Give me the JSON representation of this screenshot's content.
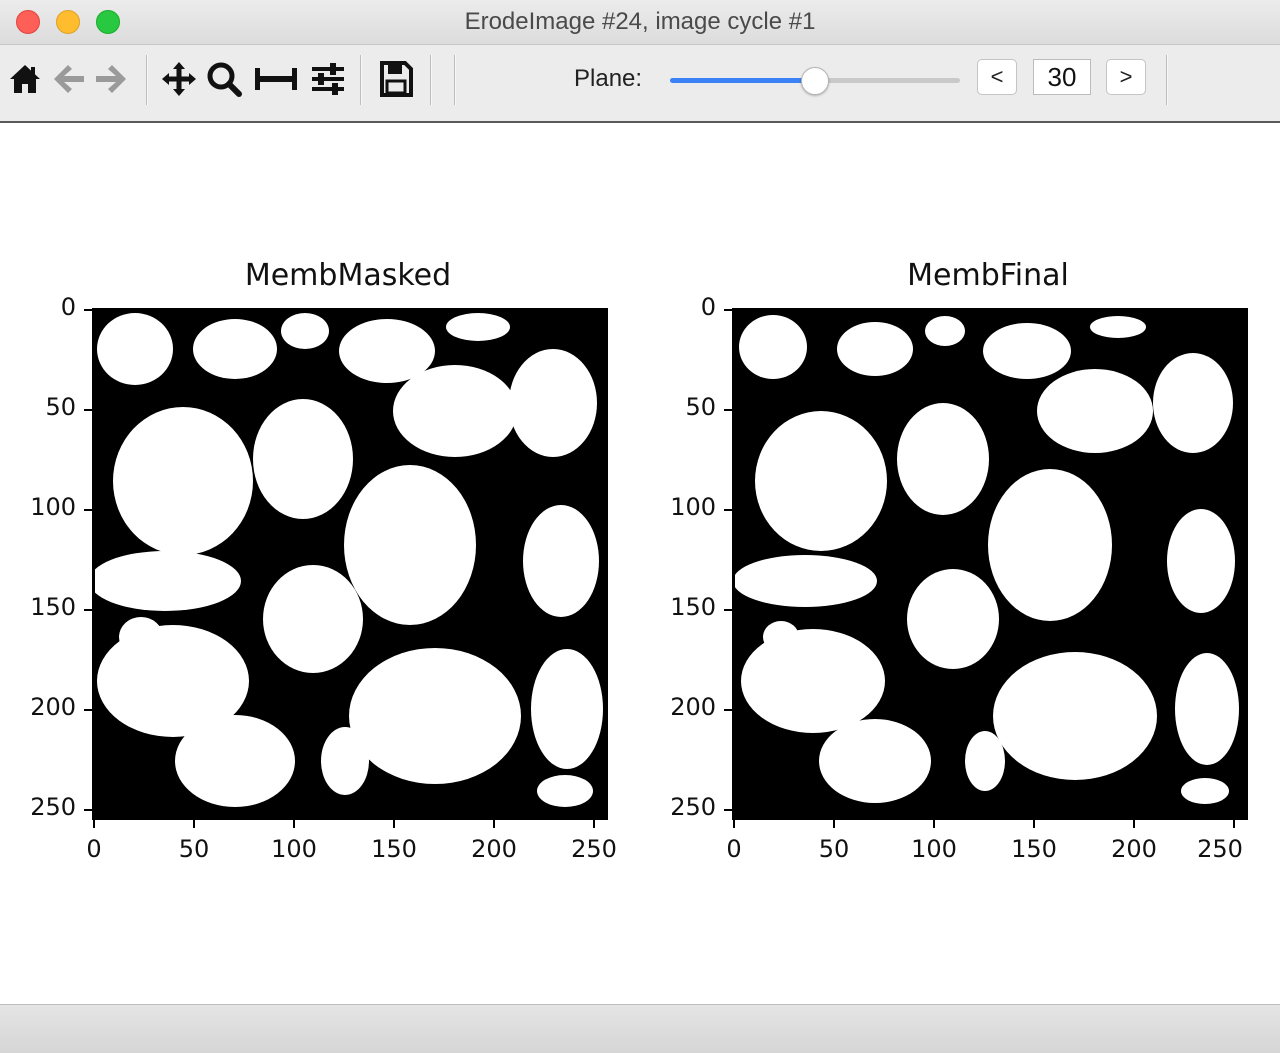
{
  "window": {
    "title": "ErodeImage #24, image cycle #1"
  },
  "toolbar": {
    "icons": [
      "home-icon",
      "back-arrow-icon",
      "forward-arrow-icon",
      "pan-move-icon",
      "zoom-magnifier-icon",
      "subplots-adjust-icon",
      "configure-sliders-icon",
      "save-floppy-icon"
    ],
    "plane_label": "Plane:",
    "plane_value": "30",
    "plane_fraction": 0.5,
    "prev_label": "<",
    "next_label": ">"
  },
  "plots": [
    {
      "title": "MembMasked",
      "yticks": [
        "0",
        "50",
        "100",
        "150",
        "200",
        "250"
      ],
      "xticks": [
        "0",
        "50",
        "100",
        "150",
        "200",
        "250"
      ]
    },
    {
      "title": "MembFinal",
      "yticks": [
        "0",
        "50",
        "100",
        "150",
        "200",
        "250"
      ],
      "xticks": [
        "0",
        "50",
        "100",
        "150",
        "200",
        "250"
      ]
    }
  ]
}
